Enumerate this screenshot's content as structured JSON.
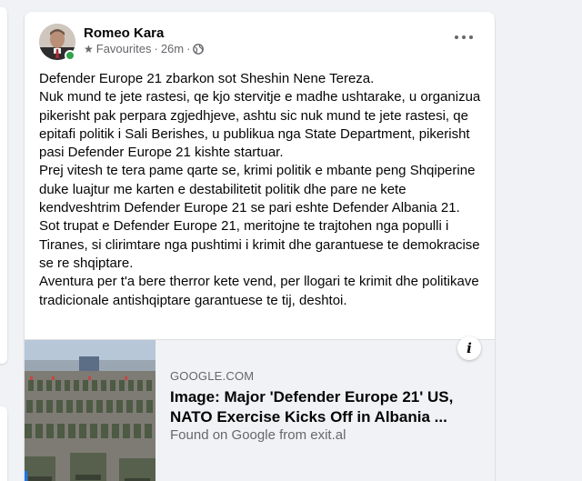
{
  "post": {
    "author": "Romeo Kara",
    "audience_label": "Favourites",
    "separator": "·",
    "time": "26m",
    "separator2": "·",
    "privacy_icon": "globe-icon",
    "more_icon": "more-horizontal-icon",
    "paragraphs": [
      "Defender Europe 21 zbarkon sot Sheshin Nene Tereza.",
      "Nuk mund te jete rastesi, qe kjo stervitje e madhe ushtarake, u organizua pikerisht pak perpara zgjedhjeve, ashtu sic nuk mund te jete rastesi, qe epitafi politik i Sali Berishes, u publikua nga State Department, pikerisht pasi Defender Europe 21 kishte startuar.",
      "Prej vitesh te tera pame qarte se, krimi politik e mbante peng Shqiperine duke luajtur me karten e destabilitetit politik dhe pare ne kete kendveshtrim Defender Europe 21 se pari eshte Defender Albania 21.",
      "Sot trupat e Defender Europe 21, meritojne te trajtohen nga populli i Tiranes, si clirimtare nga pushtimi i krimit dhe garantuese te demokracise se re shqiptare.",
      "Aventura per t'a bere therror kete vend, per llogari te krimit dhe politikave tradicionale antishqiptare garantuese te tij, deshtoi."
    ]
  },
  "link_preview": {
    "domain": "GOOGLE.COM",
    "title": "Image: Major 'Defender Europe 21' US, NATO Exercise Kicks Off in Albania ...",
    "description": "Found on Google from exit.al",
    "info_icon": "info-icon"
  },
  "colors": {
    "background": "#f0f2f5",
    "online": "#31a24c",
    "secondary_text": "#65676b",
    "accent": "#1877f2"
  }
}
